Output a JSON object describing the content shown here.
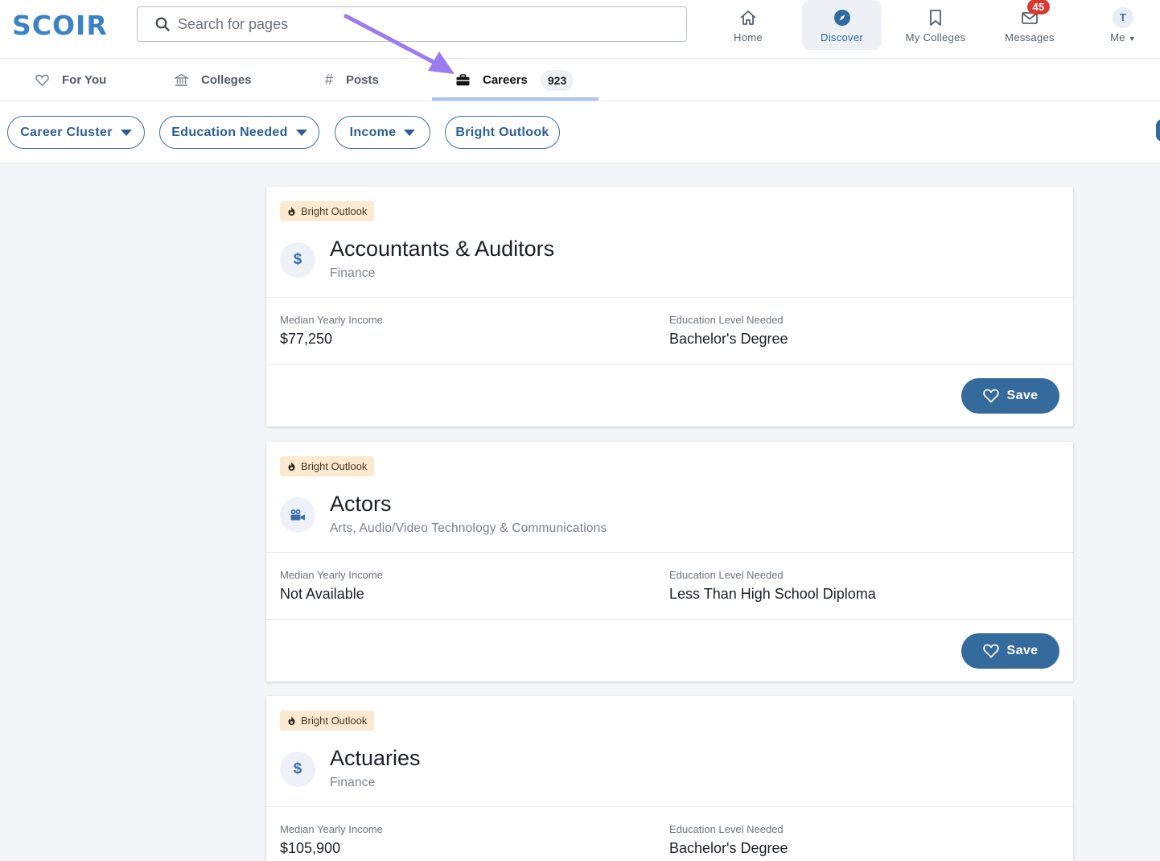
{
  "header": {
    "logo": "SCOIR",
    "search_placeholder": "Search for pages",
    "nav": [
      {
        "label": "Home",
        "icon": "home-icon"
      },
      {
        "label": "Discover",
        "icon": "compass-icon",
        "active": true
      },
      {
        "label": "My Colleges",
        "icon": "bookmark-icon"
      },
      {
        "label": "Messages",
        "icon": "envelope-icon",
        "badge": "45"
      },
      {
        "label": "Me",
        "avatar": "T"
      }
    ]
  },
  "tabs": [
    {
      "label": "For You",
      "icon": "heart-icon"
    },
    {
      "label": "Colleges",
      "icon": "institution-icon"
    },
    {
      "label": "Posts",
      "icon": "hashtag-icon"
    },
    {
      "label": "Careers",
      "icon": "briefcase-icon",
      "count": "923",
      "active": true
    }
  ],
  "filters": [
    {
      "label": "Career Cluster",
      "dropdown": true
    },
    {
      "label": "Education Needed",
      "dropdown": true
    },
    {
      "label": "Income",
      "dropdown": true
    },
    {
      "label": "Bright Outlook",
      "dropdown": false
    }
  ],
  "cards": [
    {
      "badge": "Bright Outlook",
      "icon": "dollar-icon",
      "title": "Accountants & Auditors",
      "cluster": "Finance",
      "income_label": "Median Yearly Income",
      "income": "$77,250",
      "education_label": "Education Level Needed",
      "education": "Bachelor's Degree",
      "save_label": "Save"
    },
    {
      "badge": "Bright Outlook",
      "icon": "video-camera-icon",
      "title": "Actors",
      "cluster": "Arts, Audio/Video Technology & Communications",
      "income_label": "Median Yearly Income",
      "income": "Not Available",
      "education_label": "Education Level Needed",
      "education": "Less Than High School Diploma",
      "save_label": "Save"
    },
    {
      "badge": "Bright Outlook",
      "icon": "dollar-icon",
      "title": "Actuaries",
      "cluster": "Finance",
      "income_label": "Median Yearly Income",
      "income": "$105,900",
      "education_label": "Education Level Needed",
      "education": "Bachelor's Degree"
    }
  ],
  "colors": {
    "brand": "#3b82c4",
    "primary_button": "#356a9d",
    "badge_bg": "#fbe9d0",
    "annotation_arrow": "#9b7bf0",
    "notification": "#d93a30"
  }
}
